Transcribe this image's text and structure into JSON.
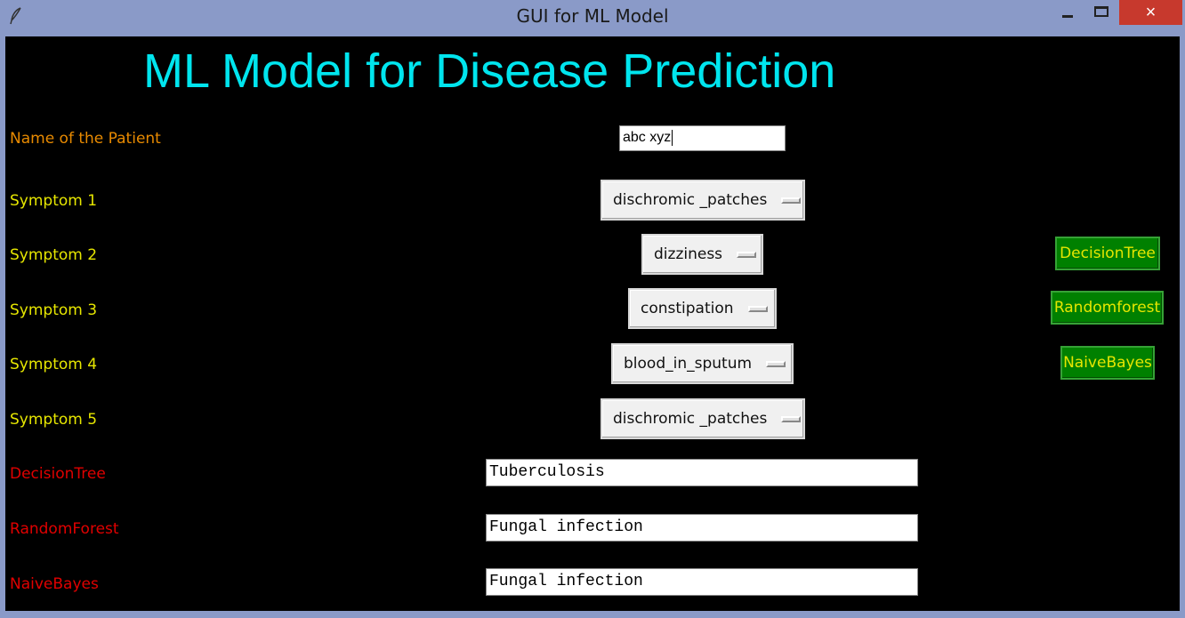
{
  "window": {
    "title": "GUI for ML Model",
    "icon": "feather-icon",
    "controls": {
      "minimize": "minimize-icon",
      "maximize": "maximize-icon",
      "close": "×"
    }
  },
  "heading": "ML Model for Disease Prediction",
  "patient": {
    "label": "Name of the Patient",
    "value": "abc xyz"
  },
  "symptoms": [
    {
      "label": "Symptom 1",
      "selected": "dischromic _patches"
    },
    {
      "label": "Symptom 2",
      "selected": "dizziness"
    },
    {
      "label": "Symptom 3",
      "selected": "constipation"
    },
    {
      "label": "Symptom 4",
      "selected": "blood_in_sputum"
    },
    {
      "label": "Symptom 5",
      "selected": "dischromic _patches"
    }
  ],
  "buttons": {
    "decision_tree": "DecisionTree",
    "random_forest": "Randomforest",
    "naive_bayes": "NaiveBayes"
  },
  "results": [
    {
      "label": "DecisionTree",
      "value": "Tuberculosis"
    },
    {
      "label": "RandomForest",
      "value": "Fungal infection"
    },
    {
      "label": "NaiveBayes",
      "value": "Fungal infection"
    }
  ],
  "colors": {
    "heading": "#00e5ee",
    "name_label": "#e88a00",
    "symptom_label": "#e6e600",
    "result_label": "#e00000",
    "button_bg": "#008000",
    "button_text": "#e6e600",
    "background": "#000000"
  }
}
